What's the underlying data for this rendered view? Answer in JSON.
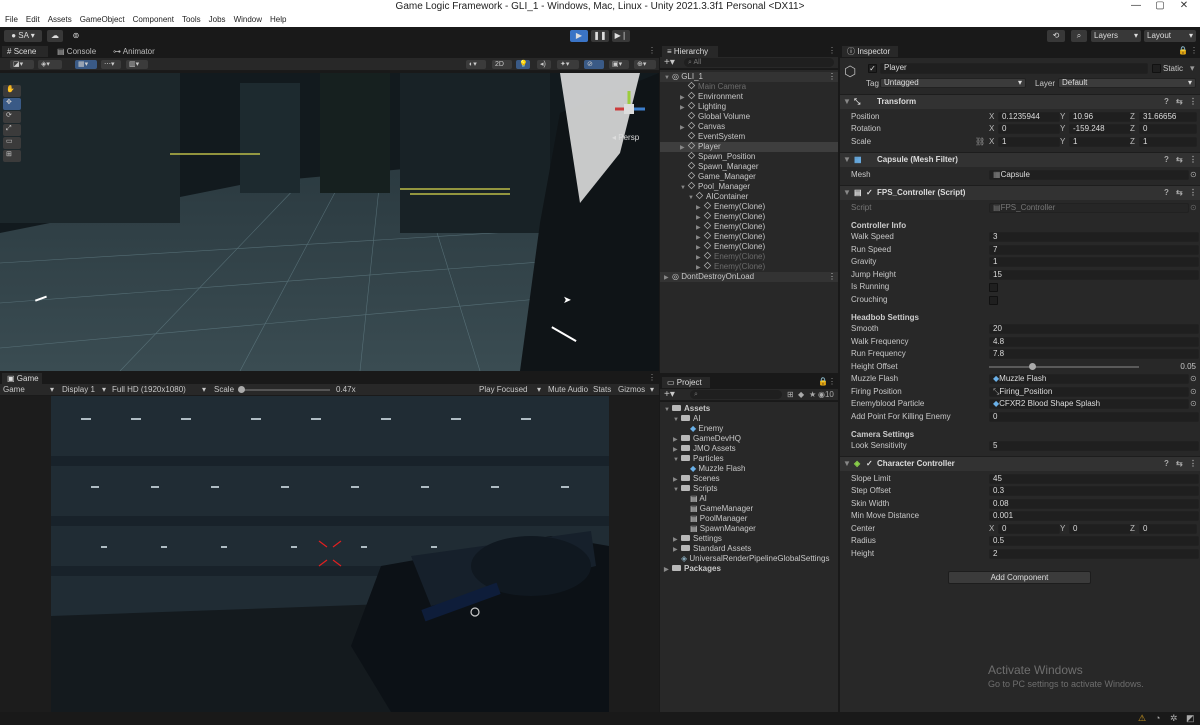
{
  "window": {
    "title": "Game Logic Framework - GLI_1 - Windows, Mac, Linux - Unity 2021.3.3f1 Personal <DX11>"
  },
  "menu": [
    "File",
    "Edit",
    "Assets",
    "GameObject",
    "Component",
    "Tools",
    "Jobs",
    "Window",
    "Help"
  ],
  "toolbar": {
    "account": "SA",
    "layers": "Layers",
    "layout": "Layout"
  },
  "scene_tabs": [
    "Scene",
    "Console",
    "Animator"
  ],
  "scene_view": {
    "mode": "2D",
    "persp": "Persp"
  },
  "game": {
    "tab": "Game",
    "display_mode": "Game",
    "display": "Display 1",
    "resolution": "Full HD (1920x1080)",
    "scale_label": "Scale",
    "scale_value": "0.47x",
    "play_focused": "Play Focused",
    "mute": "Mute Audio",
    "stats": "Stats",
    "gizmos": "Gizmos"
  },
  "hierarchy": {
    "tab": "Hierarchy",
    "search": "All",
    "items": [
      {
        "label": "GLI_1",
        "depth": 0,
        "kind": "scene",
        "arrow": "▼",
        "dim": false,
        "sel": false
      },
      {
        "label": "Main Camera",
        "depth": 2,
        "kind": "obj",
        "arrow": "",
        "dim": true,
        "sel": false
      },
      {
        "label": "Environment",
        "depth": 2,
        "kind": "obj",
        "arrow": "▶",
        "dim": false,
        "sel": false
      },
      {
        "label": "Lighting",
        "depth": 2,
        "kind": "obj",
        "arrow": "▶",
        "dim": false,
        "sel": false
      },
      {
        "label": "Global Volume",
        "depth": 2,
        "kind": "obj",
        "arrow": "",
        "dim": false,
        "sel": false
      },
      {
        "label": "Canvas",
        "depth": 2,
        "kind": "obj",
        "arrow": "▶",
        "dim": false,
        "sel": false
      },
      {
        "label": "EventSystem",
        "depth": 2,
        "kind": "obj",
        "arrow": "",
        "dim": false,
        "sel": false
      },
      {
        "label": "Player",
        "depth": 2,
        "kind": "obj",
        "arrow": "▶",
        "dim": false,
        "sel": true
      },
      {
        "label": "Spawn_Position",
        "depth": 2,
        "kind": "obj",
        "arrow": "",
        "dim": false,
        "sel": false
      },
      {
        "label": "Spawn_Manager",
        "depth": 2,
        "kind": "obj",
        "arrow": "",
        "dim": false,
        "sel": false
      },
      {
        "label": "Game_Manager",
        "depth": 2,
        "kind": "obj",
        "arrow": "",
        "dim": false,
        "sel": false
      },
      {
        "label": "Pool_Manager",
        "depth": 2,
        "kind": "obj",
        "arrow": "▼",
        "dim": false,
        "sel": false
      },
      {
        "label": "AIContainer",
        "depth": 3,
        "kind": "obj",
        "arrow": "▼",
        "dim": false,
        "sel": false
      },
      {
        "label": "Enemy(Clone)",
        "depth": 4,
        "kind": "obj",
        "arrow": "▶",
        "dim": false,
        "sel": false
      },
      {
        "label": "Enemy(Clone)",
        "depth": 4,
        "kind": "obj",
        "arrow": "▶",
        "dim": false,
        "sel": false
      },
      {
        "label": "Enemy(Clone)",
        "depth": 4,
        "kind": "obj",
        "arrow": "▶",
        "dim": false,
        "sel": false
      },
      {
        "label": "Enemy(Clone)",
        "depth": 4,
        "kind": "obj",
        "arrow": "▶",
        "dim": false,
        "sel": false
      },
      {
        "label": "Enemy(Clone)",
        "depth": 4,
        "kind": "obj",
        "arrow": "▶",
        "dim": false,
        "sel": false
      },
      {
        "label": "Enemy(Clone)",
        "depth": 4,
        "kind": "obj",
        "arrow": "▶",
        "dim": true,
        "sel": false
      },
      {
        "label": "Enemy(Clone)",
        "depth": 4,
        "kind": "obj",
        "arrow": "▶",
        "dim": true,
        "sel": false
      },
      {
        "label": "DontDestroyOnLoad",
        "depth": 0,
        "kind": "scene",
        "arrow": "▶",
        "dim": false,
        "sel": false
      }
    ]
  },
  "project": {
    "tab": "Project",
    "count": "10",
    "items": [
      {
        "label": "Assets",
        "depth": 0,
        "kind": "folder",
        "arrow": "▼",
        "bold": true
      },
      {
        "label": "AI",
        "depth": 1,
        "kind": "folder",
        "arrow": "▼",
        "bold": false
      },
      {
        "label": "Enemy",
        "depth": 2,
        "kind": "prefab",
        "arrow": "",
        "bold": false
      },
      {
        "label": "GameDevHQ",
        "depth": 1,
        "kind": "folder",
        "arrow": "▶",
        "bold": false
      },
      {
        "label": "JMO Assets",
        "depth": 1,
        "kind": "folder",
        "arrow": "▶",
        "bold": false
      },
      {
        "label": "Particles",
        "depth": 1,
        "kind": "folder",
        "arrow": "▼",
        "bold": false
      },
      {
        "label": "Muzzle Flash",
        "depth": 2,
        "kind": "prefab",
        "arrow": "",
        "bold": false
      },
      {
        "label": "Scenes",
        "depth": 1,
        "kind": "folder",
        "arrow": "▶",
        "bold": false
      },
      {
        "label": "Scripts",
        "depth": 1,
        "kind": "folder",
        "arrow": "▼",
        "bold": false
      },
      {
        "label": "AI",
        "depth": 2,
        "kind": "script",
        "arrow": "",
        "bold": false
      },
      {
        "label": "GameManager",
        "depth": 2,
        "kind": "script",
        "arrow": "",
        "bold": false
      },
      {
        "label": "PoolManager",
        "depth": 2,
        "kind": "script",
        "arrow": "",
        "bold": false
      },
      {
        "label": "SpawnManager",
        "depth": 2,
        "kind": "script",
        "arrow": "",
        "bold": false
      },
      {
        "label": "Settings",
        "depth": 1,
        "kind": "folder",
        "arrow": "▶",
        "bold": false
      },
      {
        "label": "Standard Assets",
        "depth": 1,
        "kind": "folder",
        "arrow": "▶",
        "bold": false
      },
      {
        "label": "UniversalRenderPipelineGlobalSettings",
        "depth": 1,
        "kind": "asset",
        "arrow": "",
        "bold": false
      },
      {
        "label": "Packages",
        "depth": 0,
        "kind": "folder",
        "arrow": "▶",
        "bold": true
      }
    ]
  },
  "inspector": {
    "tab": "Inspector",
    "object_name": "Player",
    "static": "Static",
    "tag_label": "Tag",
    "tag": "Untagged",
    "layer_label": "Layer",
    "layer": "Default",
    "transform": {
      "title": "Transform",
      "position": {
        "label": "Position",
        "x": "0.1235944",
        "y": "10.96",
        "z": "31.66656"
      },
      "rotation": {
        "label": "Rotation",
        "x": "0",
        "y": "-159.248",
        "z": "0"
      },
      "scale": {
        "label": "Scale",
        "x": "1",
        "y": "1",
        "z": "1"
      }
    },
    "mesh_filter": {
      "title": "Capsule (Mesh Filter)",
      "mesh_label": "Mesh",
      "mesh": "Capsule"
    },
    "fps": {
      "title": "FPS_Controller (Script)",
      "script_label": "Script",
      "script": "FPS_Controller",
      "controller_info": "Controller Info",
      "walk_speed": {
        "label": "Walk Speed",
        "value": "3"
      },
      "run_speed": {
        "label": "Run Speed",
        "value": "7"
      },
      "gravity": {
        "label": "Gravity",
        "value": "1"
      },
      "jump_height": {
        "label": "Jump Height",
        "value": "15"
      },
      "is_running": {
        "label": "Is Running",
        "checked": false
      },
      "crouching": {
        "label": "Crouching",
        "checked": false
      },
      "headbob": "Headbob Settings",
      "smooth": {
        "label": "Smooth",
        "value": "20"
      },
      "walk_freq": {
        "label": "Walk Frequency",
        "value": "4.8"
      },
      "run_freq": {
        "label": "Run Frequency",
        "value": "7.8"
      },
      "height_offset": {
        "label": "Height Offset",
        "value": "0.05"
      },
      "muzzle_flash": {
        "label": "Muzzle Flash",
        "value": "Muzzle Flash"
      },
      "firing_position": {
        "label": "Firing Position",
        "value": "Firing_Position"
      },
      "enemyblood": {
        "label": "Enemyblood Particle",
        "value": "CFXR2 Blood Shape Splash"
      },
      "add_point": {
        "label": "Add Point For Killing Enemy",
        "value": "0"
      },
      "camera_settings": "Camera Settings",
      "look_sensitivity": {
        "label": "Look Sensitivity",
        "value": "5"
      }
    },
    "cc": {
      "title": "Character Controller",
      "slope": {
        "label": "Slope Limit",
        "value": "45"
      },
      "step": {
        "label": "Step Offset",
        "value": "0.3"
      },
      "skin": {
        "label": "Skin Width",
        "value": "0.08"
      },
      "minmove": {
        "label": "Min Move Distance",
        "value": "0.001"
      },
      "center": {
        "label": "Center",
        "x": "0",
        "y": "0",
        "z": "0"
      },
      "radius": {
        "label": "Radius",
        "value": "0.5"
      },
      "height": {
        "label": "Height",
        "value": "2"
      }
    },
    "add_component": "Add Component"
  },
  "watermark": {
    "line1": "Activate Windows",
    "line2": "Go to PC settings to activate Windows."
  },
  "colors": {
    "accent": "#3a74c6",
    "panel": "#282828",
    "bg": "#191919",
    "prefab": "#6ab0e8"
  }
}
